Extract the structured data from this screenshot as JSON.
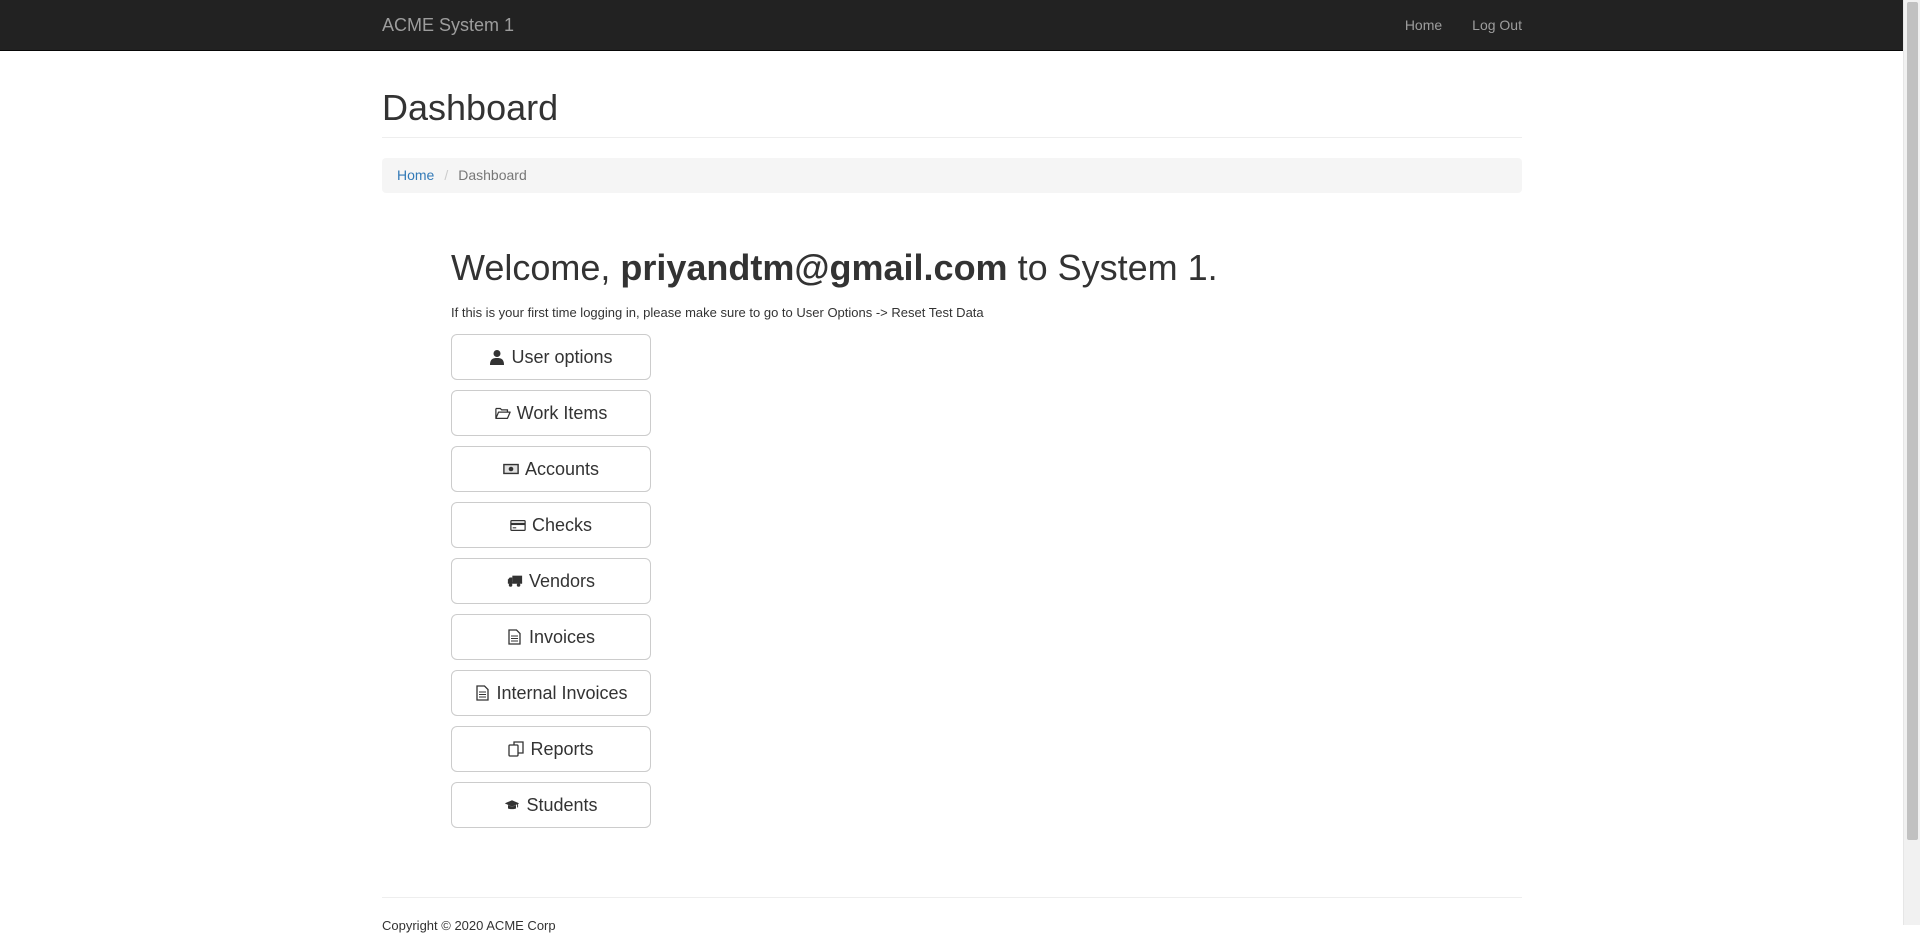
{
  "navbar": {
    "brand": "ACME System 1",
    "links": {
      "home": "Home",
      "logout": "Log Out"
    }
  },
  "page": {
    "title": "Dashboard"
  },
  "breadcrumb": {
    "home": "Home",
    "separator": "/",
    "current": "Dashboard"
  },
  "welcome": {
    "prefix": "Welcome, ",
    "email": "priyandtm@gmail.com",
    "suffix": " to System 1.",
    "note": "If this is your first time logging in, please make sure to go to User Options -> Reset Test Data"
  },
  "menu": {
    "user_options": {
      "label": "User options",
      "icon": "user-icon"
    },
    "work_items": {
      "label": "Work Items",
      "icon": "folder-open-icon"
    },
    "accounts": {
      "label": "Accounts",
      "icon": "money-icon"
    },
    "checks": {
      "label": "Checks",
      "icon": "credit-card-icon"
    },
    "vendors": {
      "label": "Vendors",
      "icon": "truck-icon"
    },
    "invoices": {
      "label": "Invoices",
      "icon": "document-icon"
    },
    "internal_invoices": {
      "label": "Internal Invoices",
      "icon": "document-icon"
    },
    "reports": {
      "label": "Reports",
      "icon": "copy-icon"
    },
    "students": {
      "label": "Students",
      "icon": "graduation-cap-icon"
    }
  },
  "footer": {
    "text": "Copyright © 2020 ACME Corp"
  }
}
